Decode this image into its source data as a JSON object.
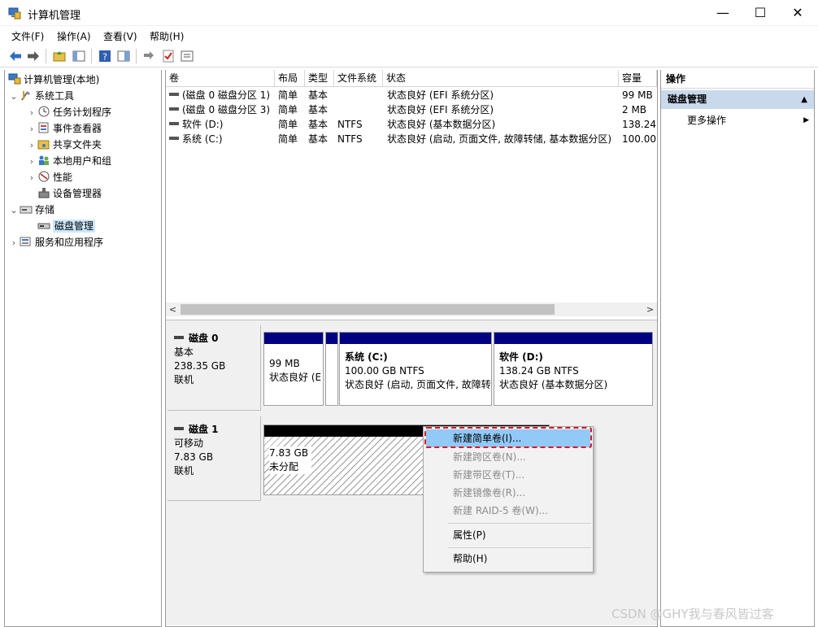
{
  "window": {
    "title": "计算机管理",
    "min": "—",
    "max": "☐",
    "close": "✕"
  },
  "menu": [
    "文件(F)",
    "操作(A)",
    "查看(V)",
    "帮助(H)"
  ],
  "tree": {
    "root": "计算机管理(本地)",
    "system_tools": "系统工具",
    "task_scheduler": "任务计划程序",
    "event_viewer": "事件查看器",
    "shared_folders": "共享文件夹",
    "local_users": "本地用户和组",
    "performance": "性能",
    "device_manager": "设备管理器",
    "storage": "存储",
    "disk_management": "磁盘管理",
    "services": "服务和应用程序"
  },
  "volume_table": {
    "headers": [
      "卷",
      "布局",
      "类型",
      "文件系统",
      "状态",
      "容量"
    ],
    "rows": [
      [
        "(磁盘 0 磁盘分区 1)",
        "简单",
        "基本",
        "",
        "状态良好 (EFI 系统分区)",
        "99 MB"
      ],
      [
        "(磁盘 0 磁盘分区 3)",
        "简单",
        "基本",
        "",
        "状态良好 (EFI 系统分区)",
        "2 MB"
      ],
      [
        "软件 (D:)",
        "简单",
        "基本",
        "NTFS",
        "状态良好 (基本数据分区)",
        "138.24"
      ],
      [
        "系统 (C:)",
        "简单",
        "基本",
        "NTFS",
        "状态良好 (启动, 页面文件, 故障转储, 基本数据分区)",
        "100.00"
      ]
    ]
  },
  "disks": {
    "disk0": {
      "name": "磁盘 0",
      "type": "基本",
      "size": "238.35 GB",
      "status": "联机",
      "p1_size": "99 MB",
      "p1_status": "状态良好 (E",
      "p3_title": "系统  (C:)",
      "p3_size": "100.00 GB NTFS",
      "p3_status": "状态良好 (启动, 页面文件, 故障转",
      "p4_title": "软件  (D:)",
      "p4_size": "138.24 GB NTFS",
      "p4_status": "状态良好 (基本数据分区)"
    },
    "disk1": {
      "name": "磁盘 1",
      "type": "可移动",
      "size": "7.83 GB",
      "status": "联机",
      "u_size": "7.83 GB",
      "u_status": "未分配"
    }
  },
  "context_menu": {
    "new_simple": "新建简单卷(I)...",
    "new_spanned": "新建跨区卷(N)...",
    "new_striped": "新建带区卷(T)...",
    "new_mirror": "新建镜像卷(R)...",
    "new_raid5": "新建 RAID-5 卷(W)...",
    "properties": "属性(P)",
    "help": "帮助(H)"
  },
  "actions": {
    "header": "操作",
    "section": "磁盘管理",
    "more": "更多操作"
  },
  "watermark": "CSDN @GHY我与春风皆过客",
  "colors": {
    "partition_bar": "#000080",
    "unallocated_bar": "#000000",
    "highlight": "#e0141e",
    "menu_hot": "#91c9f7"
  }
}
